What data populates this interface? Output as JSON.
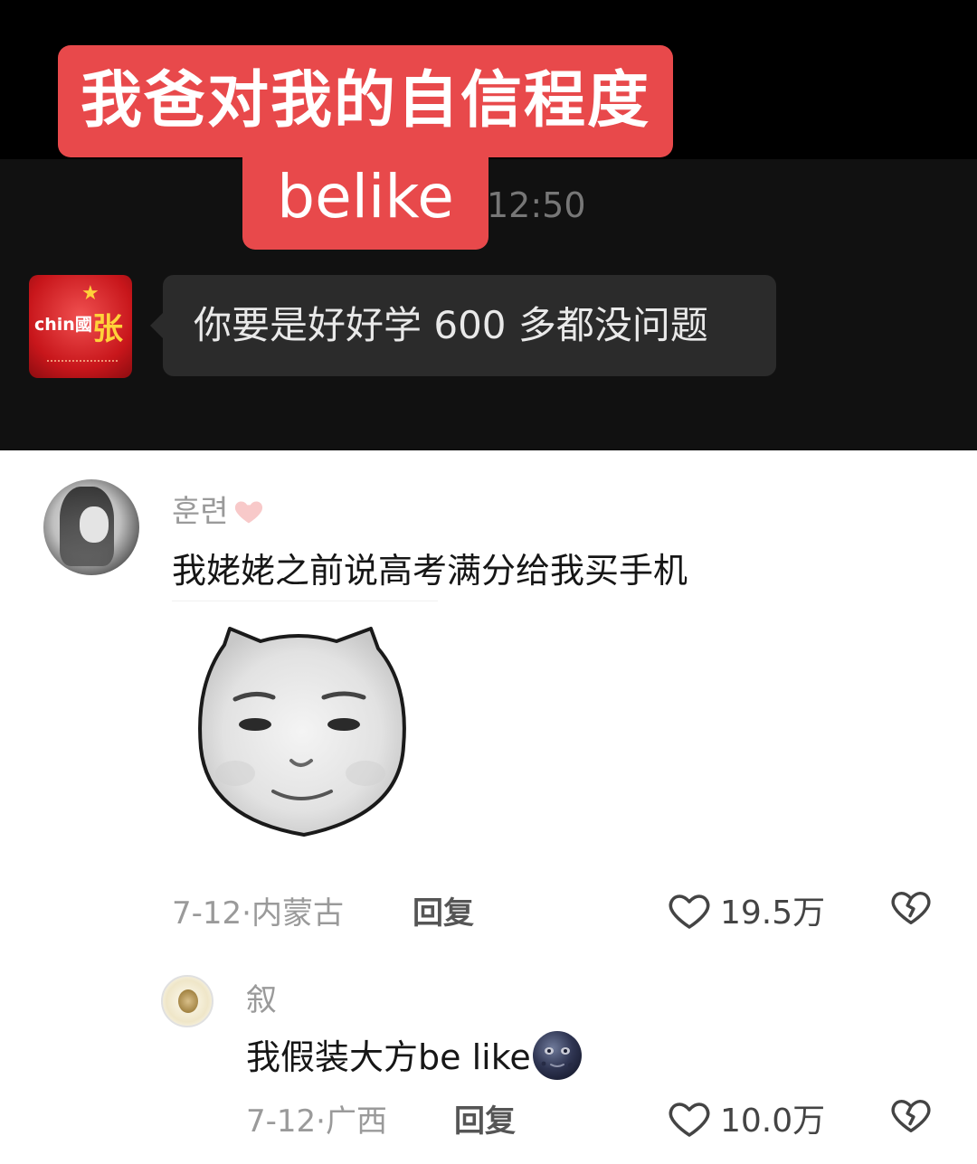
{
  "post": {
    "caption_line1": "我爸对我的自信程度",
    "caption_line2": "belike",
    "chat_time": "12:50",
    "sender_avatar_text": "chin國",
    "sender_avatar_char": "张",
    "message": "你要是好好学 600 多都没问题"
  },
  "comments": [
    {
      "username": "훈련",
      "text": "我姥姥之前说高考满分给我买手机",
      "sticker": "pig-face-meme-sticker",
      "date": "7-12",
      "location": "内蒙古",
      "reply_label": "回复",
      "likes": "19.5万"
    },
    {
      "username": "叙",
      "text": "我假装大方be like",
      "emoji": "new-moon-face",
      "date": "7-12",
      "location": "广西",
      "reply_label": "回复",
      "likes": "10.0万"
    }
  ],
  "colors": {
    "caption_bg": "#e8494b",
    "bubble_bg": "#2b2b2b",
    "username": "#9a9a9a",
    "heart_pink": "#f8c9c9"
  }
}
